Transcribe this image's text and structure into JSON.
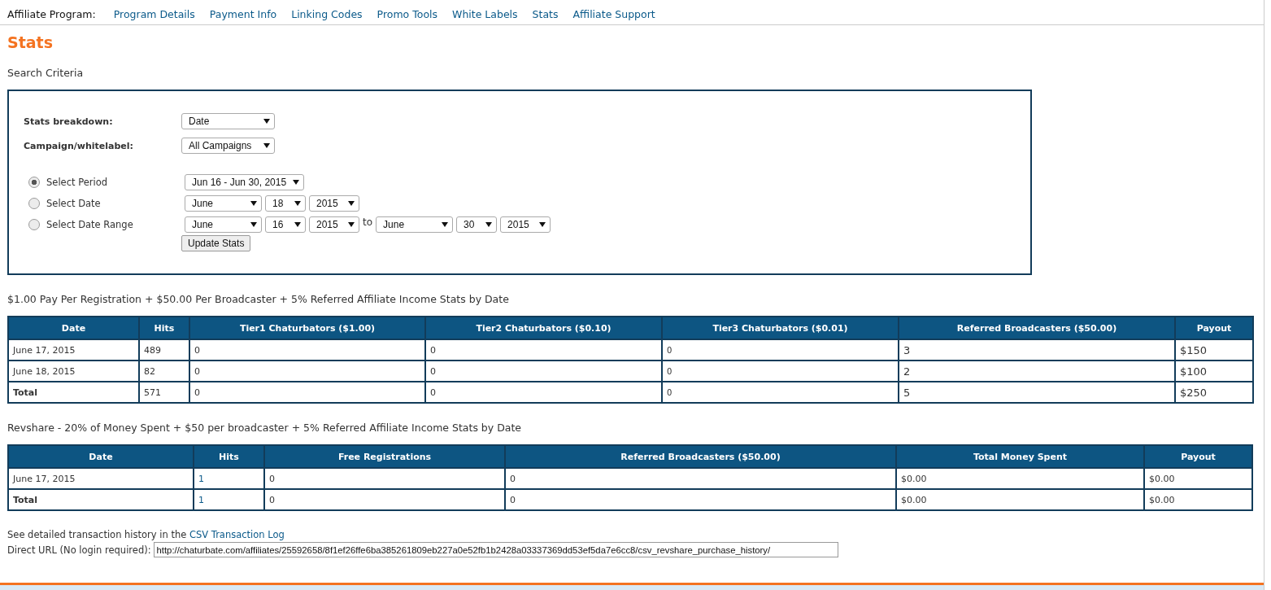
{
  "nav": {
    "label": "Affiliate Program:",
    "links": [
      "Program Details",
      "Payment Info",
      "Linking Codes",
      "Promo Tools",
      "White Labels",
      "Stats",
      "Affiliate Support"
    ]
  },
  "title": "Stats",
  "search_criteria": {
    "heading": "Search Criteria",
    "fields": [
      {
        "label": "Stats breakdown:",
        "value": "Date"
      },
      {
        "label": "Campaign/whitelabel:",
        "value": "All Campaigns"
      }
    ],
    "period_options": [
      {
        "label": "Select Period",
        "selected": true,
        "controls": [
          {
            "kind": "select",
            "value": "Jun 16 - Jun 30, 2015"
          }
        ]
      },
      {
        "label": "Select Date",
        "selected": false,
        "controls": [
          {
            "kind": "select",
            "value": "June"
          },
          {
            "kind": "select",
            "value": "18"
          },
          {
            "kind": "select",
            "value": "2015"
          }
        ]
      },
      {
        "label": "Select Date Range",
        "selected": false,
        "controls": [
          {
            "kind": "select",
            "value": "June"
          },
          {
            "kind": "select",
            "value": "16"
          },
          {
            "kind": "select",
            "value": "2015"
          },
          {
            "kind": "text",
            "value": "to"
          },
          {
            "kind": "select",
            "value": "June"
          },
          {
            "kind": "select",
            "value": "30"
          },
          {
            "kind": "select",
            "value": "2015"
          }
        ]
      }
    ],
    "button": "Update Stats"
  },
  "tables": [
    {
      "title": "$1.00 Pay Per Registration + $50.00 Per Broadcaster + 5% Referred Affiliate Income Stats by Date",
      "columns": [
        {
          "label": "Date",
          "kind": "text"
        },
        {
          "label": "Hits",
          "kind": "text"
        },
        {
          "label": "Tier1 Chaturbators ($1.00)",
          "kind": "text"
        },
        {
          "label": "Tier2 Chaturbators ($0.10)",
          "kind": "text"
        },
        {
          "label": "Tier3 Chaturbators ($0.01)",
          "kind": "small"
        },
        {
          "label": "Referred Broadcasters ($50.00)",
          "kind": "large"
        },
        {
          "label": "Payout",
          "kind": "large"
        }
      ],
      "rows": [
        {
          "kind": "data",
          "cells": [
            "June 17, 2015",
            "489",
            "0",
            "0",
            "0",
            "3",
            "$150"
          ]
        },
        {
          "kind": "data",
          "cells": [
            "June 18, 2015",
            "82",
            "0",
            "0",
            "0",
            "2",
            "$100"
          ]
        },
        {
          "kind": "total",
          "cells": [
            "Total",
            "571",
            "0",
            "0",
            "0",
            "5",
            "$250"
          ]
        }
      ]
    },
    {
      "title": "Revshare - 20% of Money Spent + $50 per broadcaster + 5% Referred Affiliate Income Stats by Date",
      "columns": [
        {
          "label": "Date",
          "kind": "text"
        },
        {
          "label": "Hits",
          "kind": "link"
        },
        {
          "label": "Free Registrations",
          "kind": "text"
        },
        {
          "label": "Referred Broadcasters ($50.00)",
          "kind": "text"
        },
        {
          "label": "Total Money Spent",
          "kind": "text"
        },
        {
          "label": "Payout",
          "kind": "text"
        }
      ],
      "rows": [
        {
          "kind": "data",
          "cells": [
            "June 17, 2015",
            "1",
            "0",
            "0",
            "$0.00",
            "$0.00"
          ]
        },
        {
          "kind": "total",
          "cells": [
            "Total",
            "1",
            "0",
            "0",
            "$0.00",
            "$0.00"
          ]
        }
      ]
    }
  ],
  "footer": {
    "history_text": "See detailed transaction history in the",
    "history_link": "CSV Transaction Log",
    "url_label": "Direct URL (No login required):",
    "url_value": "http://chaturbate.com/affiliates/25592658/8f1ef26ffe6ba385261809eb227a0e52fb1b2428a03337369dd53ef5da7e6cc8/csv_revshare_purchase_history/"
  }
}
